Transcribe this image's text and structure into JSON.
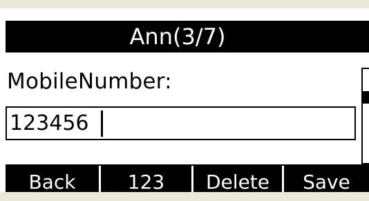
{
  "contact": {
    "title": "Ann(3/7)"
  },
  "field": {
    "label": "MobileNumber:",
    "value": "123456"
  },
  "softkeys": {
    "back": "Back",
    "input_mode": "123",
    "delete": "Delete",
    "save": "Save"
  }
}
